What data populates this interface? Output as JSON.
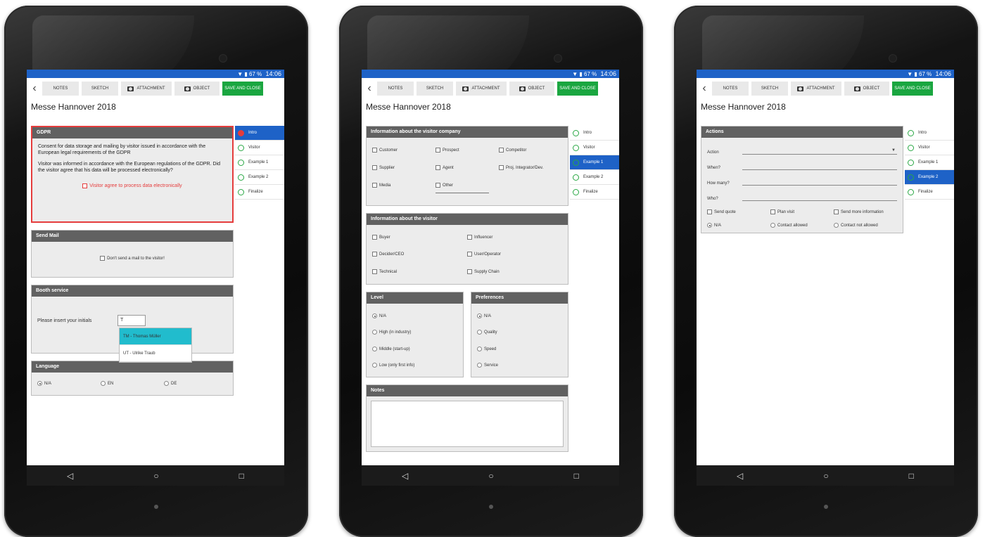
{
  "common": {
    "status_battery": "67 %",
    "status_time": "14:06",
    "toolbar": {
      "notes": "NOTES",
      "sketch": "SKETCH",
      "attachment": "ATTACHMENT",
      "object": "OBJECT",
      "save_close": "SAVE AND CLOSE"
    },
    "title": "Messe Hannover 2018",
    "nav": [
      "Intro",
      "Visitor",
      "Example 1",
      "Example 2",
      "Finalize"
    ],
    "softkeys": {
      "back": "◁",
      "home": "○",
      "recents": "□"
    }
  },
  "tablet1": {
    "active_nav": 0,
    "gdpr": {
      "header": "GDPR",
      "p1": "Consent for data storage and mailing by visitor issued in accordance with the European legal requirements of the GDPR",
      "p2": "Visitor was informed in accordance with the European regulations of the GDPR. Did the visitor agree that his data will be processed electronically?",
      "consent": "Visitor agree to process data electronically"
    },
    "send_mail": {
      "header": "Send Mail",
      "checkbox": "Don't send a mail to the visitor!"
    },
    "booth": {
      "header": "Booth service",
      "label": "Please insert your initials",
      "input_value": "T",
      "options": [
        "TM - Thomas Müller",
        "UT - Ulrike Traub"
      ]
    },
    "language": {
      "header": "Language",
      "options": [
        "N/A",
        "EN",
        "DE"
      ],
      "selected": "N/A"
    }
  },
  "tablet2": {
    "active_nav": 2,
    "company": {
      "header": "Information about the visitor company",
      "options": [
        "Customer",
        "Prospect",
        "Competitor",
        "Supplier",
        "Agent",
        "Proj. Integrator/Dev.",
        "Media",
        "Other"
      ]
    },
    "visitor": {
      "header": "Information about the visitor",
      "options": [
        "Buyer",
        "Influencer",
        "Decider/CEO",
        "User/Operator",
        "Technical",
        "Supply Chain"
      ]
    },
    "level": {
      "header": "Level",
      "options": [
        "N/A",
        "High (in industry)",
        "Middle (start-up)",
        "Low (only first info)"
      ],
      "selected": "N/A"
    },
    "preferences": {
      "header": "Preferences",
      "options": [
        "N/A",
        "Quality",
        "Speed",
        "Service"
      ],
      "selected": "N/A"
    },
    "notes": {
      "header": "Notes"
    }
  },
  "tablet3": {
    "active_nav": 3,
    "actions": {
      "header": "Actions",
      "fields": [
        "Action",
        "When?",
        "How many?",
        "Who?"
      ],
      "checkboxes": [
        "Send quote",
        "Plan visit",
        "Send more information"
      ],
      "radios": [
        "N/A",
        "Contact allowed",
        "Contact not allowed"
      ],
      "selected": "N/A"
    }
  },
  "colors": {
    "status_bar": "#1e62c7",
    "save_button": "#1aa640",
    "section_header": "#616161",
    "error": "#e53c3c",
    "highlight": "#21bccd"
  }
}
